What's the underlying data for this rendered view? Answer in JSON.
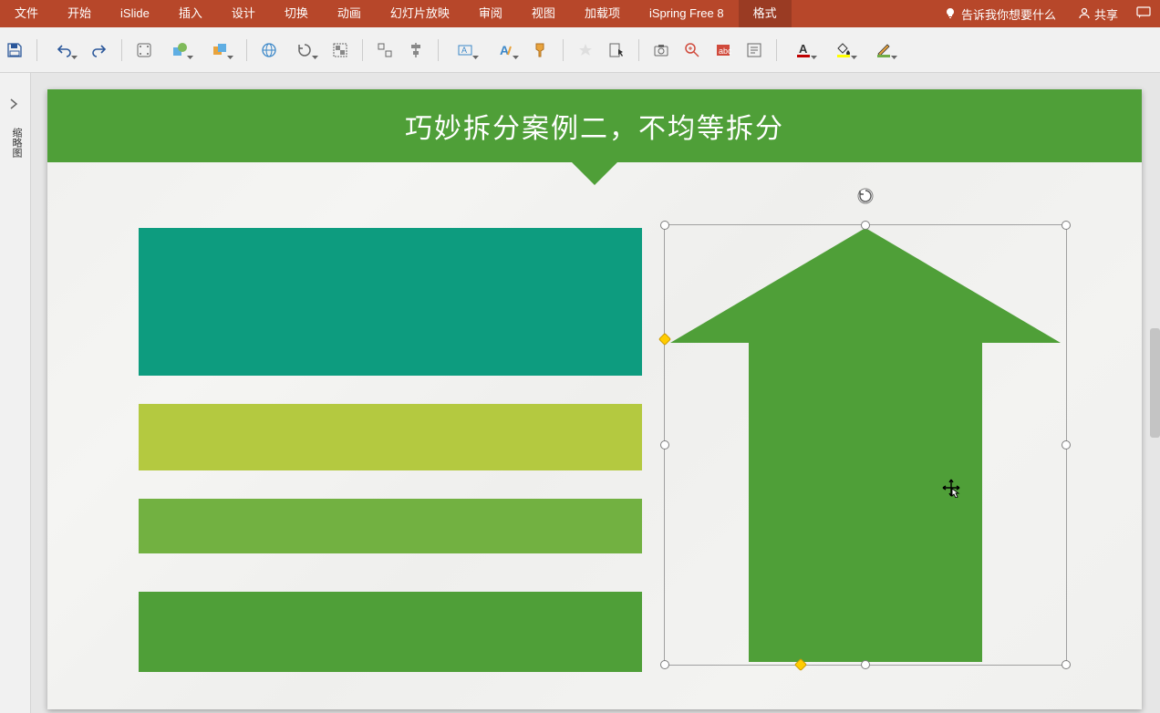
{
  "ribbon": {
    "tabs": [
      "文件",
      "开始",
      "iSlide",
      "插入",
      "设计",
      "切换",
      "动画",
      "幻灯片放映",
      "审阅",
      "视图",
      "加载项",
      "iSpring Free 8",
      "格式"
    ],
    "active_tab_index": 12,
    "tell_me": "告诉我你想要什么",
    "share": "共享"
  },
  "side": {
    "label": "缩略图"
  },
  "slide": {
    "title": "巧妙拆分案例二，不均等拆分"
  },
  "colors": {
    "brand": "#b7472a",
    "title_band": "#4f9f38",
    "bar1": "#0d9c7f",
    "bar2": "#b4c940",
    "bar3": "#72b141",
    "bar4": "#4f9f38",
    "arrow": "#4f9f38"
  }
}
